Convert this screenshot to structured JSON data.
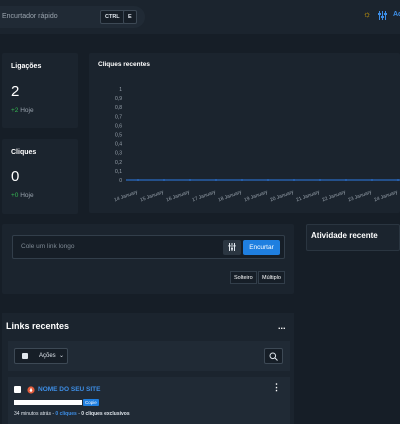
{
  "topbar": {
    "search_placeholder": "Encurtador rápido",
    "shortcut_keys": [
      "CTRL",
      "E"
    ],
    "right_label": "Ac",
    "colors": {
      "sun": "#f2b600",
      "accent": "#3d8ee6"
    },
    "icons": [
      "sun-icon",
      "sliders-icon"
    ]
  },
  "stats": {
    "links": {
      "title": "Ligações",
      "value": "2",
      "delta": "+2",
      "delta_suffix": "Hoje"
    },
    "clicks": {
      "title": "Cliques",
      "value": "0",
      "delta": "+0",
      "delta_suffix": "Hoje"
    }
  },
  "chart_data": {
    "type": "line",
    "title": "Cliques recentes",
    "x": [
      "14 January",
      "15 January",
      "16 January",
      "17 January",
      "18 January",
      "19 January",
      "20 January",
      "21 January",
      "22 January",
      "23 January",
      "24 January",
      "25 January"
    ],
    "y_ticks": [
      "1",
      "0,9",
      "0,8",
      "0,7",
      "0,6",
      "0,5",
      "0,4",
      "0,3",
      "0,2",
      "0,1",
      "0"
    ],
    "series": [
      {
        "values": [
          0,
          0,
          0,
          0,
          0,
          0,
          0,
          0,
          0,
          0,
          0,
          0
        ],
        "color": "#2c7be5"
      }
    ],
    "ylim": [
      0,
      1
    ],
    "grid": false
  },
  "activity": {
    "title": "Atividade recente"
  },
  "shortener": {
    "placeholder": "Cole um link longo",
    "button": "Encurtar",
    "modes": [
      "Solteiro",
      "Múltiplo"
    ]
  },
  "links": {
    "title": "Links recentes",
    "more": "...",
    "actions_label": "Ações",
    "item": {
      "name": "NOME DO SEU SITE",
      "copy_label": "Copie",
      "time": "34 minutos atrás",
      "sep": " - ",
      "clicks": "0 cliques",
      "unique": "0 cliques exclusivos",
      "favicon_color": "#e25c3c"
    }
  }
}
